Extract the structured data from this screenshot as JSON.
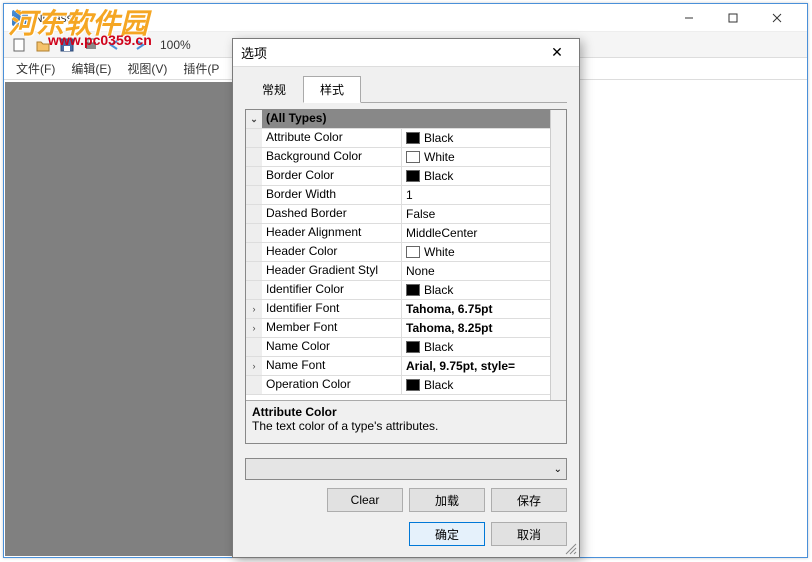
{
  "mainWindow": {
    "title": "NClass",
    "minControl": "min",
    "maxControl": "max",
    "closeControl": "close"
  },
  "toolbar": {
    "zoom": "100%"
  },
  "watermark": {
    "text": "河东软件园",
    "url": "www.pc0359.cn"
  },
  "menu": {
    "file": "文件(F)",
    "edit": "编辑(E)",
    "view": "视图(V)",
    "plugin": "插件(P"
  },
  "dialog": {
    "title": "选项",
    "tabs": {
      "general": "常规",
      "style": "样式"
    },
    "groupHeader": "(All Types)",
    "props": [
      {
        "label": "Attribute Color",
        "value": "Black",
        "swatch": "#000000",
        "expand": ""
      },
      {
        "label": "Background Color",
        "value": "White",
        "swatch": "#ffffff",
        "expand": ""
      },
      {
        "label": "Border Color",
        "value": "Black",
        "swatch": "#000000",
        "expand": ""
      },
      {
        "label": "Border Width",
        "value": "1",
        "expand": ""
      },
      {
        "label": "Dashed Border",
        "value": "False",
        "expand": ""
      },
      {
        "label": "Header Alignment",
        "value": "MiddleCenter",
        "expand": ""
      },
      {
        "label": "Header Color",
        "value": "White",
        "swatch": "#ffffff",
        "expand": ""
      },
      {
        "label": "Header Gradient Styl",
        "value": "None",
        "expand": ""
      },
      {
        "label": "Identifier Color",
        "value": "Black",
        "swatch": "#000000",
        "expand": ""
      },
      {
        "label": "Identifier Font",
        "value": "Tahoma, 6.75pt",
        "bold": true,
        "expand": "›"
      },
      {
        "label": "Member Font",
        "value": "Tahoma, 8.25pt",
        "bold": true,
        "expand": "›"
      },
      {
        "label": "Name Color",
        "value": "Black",
        "swatch": "#000000",
        "expand": ""
      },
      {
        "label": "Name Font",
        "value": "Arial, 9.75pt, style=",
        "bold": true,
        "expand": "›"
      },
      {
        "label": "Operation Color",
        "value": "Black",
        "swatch": "#000000",
        "expand": ""
      }
    ],
    "desc": {
      "title": "Attribute Color",
      "text": "The text color of a type's attributes."
    },
    "buttons": {
      "clear": "Clear",
      "load": "加载",
      "save": "保存",
      "ok": "确定",
      "cancel": "取消"
    }
  }
}
